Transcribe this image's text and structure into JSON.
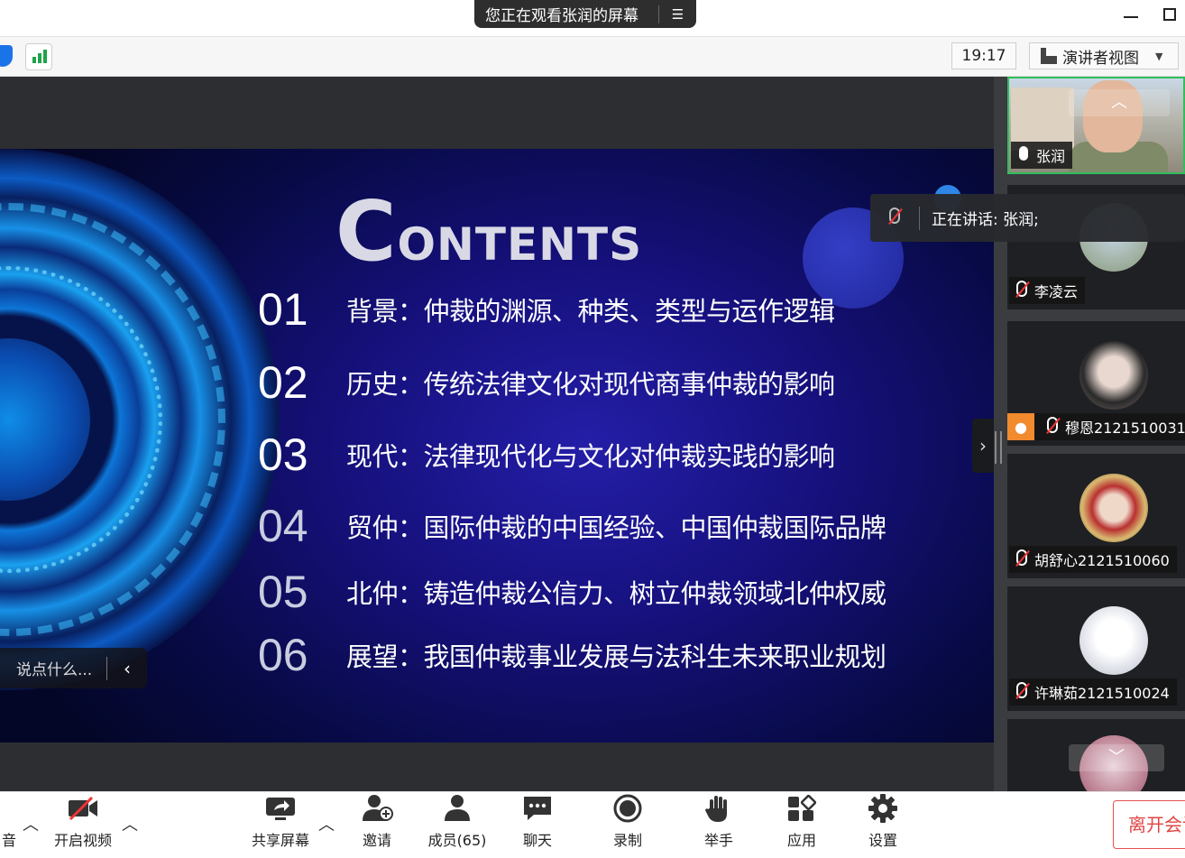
{
  "titlebar": {
    "sharing_notice": "您正在观看张润的屏幕",
    "menu_icon": "list-menu-icon"
  },
  "toolbar": {
    "time": "19:17",
    "view_mode": "演讲者视图"
  },
  "slide": {
    "title_first": "C",
    "title_rest": "ONTENTS",
    "items": [
      {
        "num": "01",
        "text": "背景：仲裁的渊源、种类、类型与运作逻辑"
      },
      {
        "num": "02",
        "text": "历史：传统法律文化对现代商事仲裁的影响"
      },
      {
        "num": "03",
        "text": "现代：法律现代化与文化对仲裁实践的影响"
      },
      {
        "num": "04",
        "text": "贸仲：国际仲裁的中国经验、中国仲裁国际品牌"
      },
      {
        "num": "05",
        "text": "北仲：铸造仲裁公信力、树立仲裁领域北仲权威"
      },
      {
        "num": "06",
        "text": "展望：我国仲裁事业发展与法科生未来职业规划"
      }
    ]
  },
  "chat_input": {
    "placeholder": "说点什么..."
  },
  "speaking": {
    "label": "正在讲话: 张润;"
  },
  "participants": [
    {
      "name": "张润",
      "muted": false
    },
    {
      "name": "李凌云",
      "muted": true
    },
    {
      "name": "穆恩2121510031",
      "muted": true
    },
    {
      "name": "胡舒心2121510060",
      "muted": true
    },
    {
      "name": "许琳茹2121510024",
      "muted": true
    }
  ],
  "bottombar": {
    "audio_label": "音",
    "video_label": "开启视频",
    "share_label": "共享屏幕",
    "invite_label": "邀请",
    "members_label": "成员(65)",
    "chat_label": "聊天",
    "record_label": "录制",
    "raise_hand_label": "举手",
    "apps_label": "应用",
    "settings_label": "设置",
    "leave_label": "离开会议"
  },
  "colors": {
    "active_speaker_border": "#2fbf5a",
    "leave_red": "#e04545",
    "slide_bg": "#15107a"
  }
}
